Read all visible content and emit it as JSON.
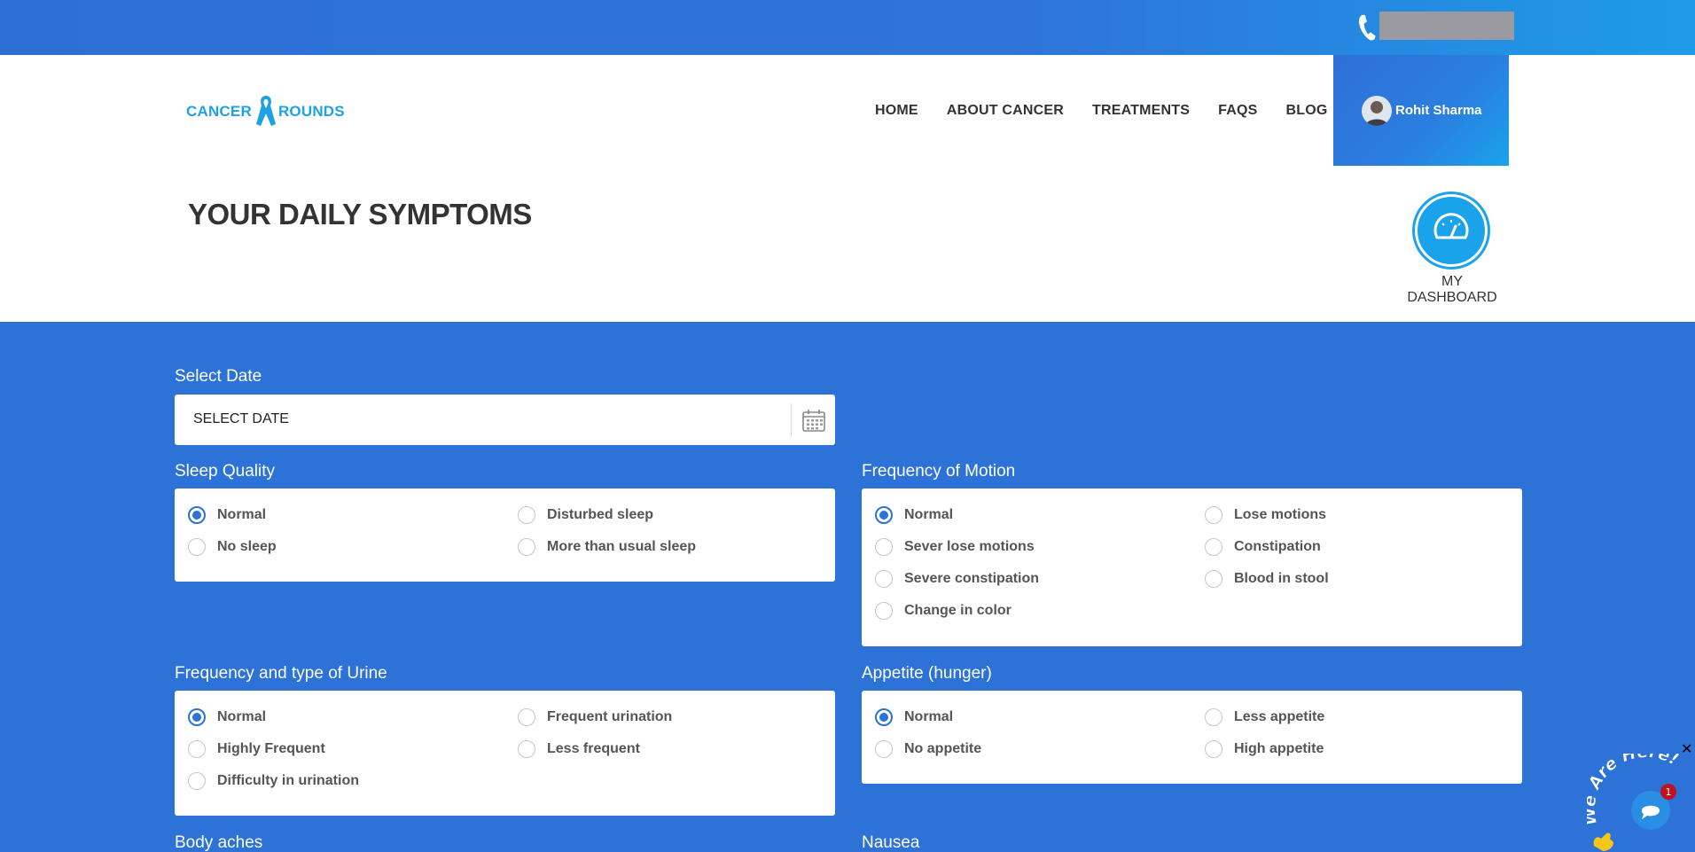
{
  "topbar": {
    "phone_icon": "phone-icon"
  },
  "logo": {
    "left": "CANCER",
    "right": "ROUNDS"
  },
  "nav": {
    "items": [
      "HOME",
      "ABOUT CANCER",
      "TREATMENTS",
      "FAQS",
      "BLOG"
    ]
  },
  "user": {
    "name": "Rohit Sharma"
  },
  "page": {
    "title": "YOUR DAILY SYMPTOMS",
    "dashboard_label": "MY DASHBOARD"
  },
  "date": {
    "label": "Select Date",
    "placeholder": "SELECT DATE"
  },
  "sections": {
    "sleep": {
      "label": "Sleep Quality",
      "options": [
        "Normal",
        "Disturbed sleep",
        "No sleep",
        "More than usual sleep"
      ],
      "selected": 0
    },
    "motion": {
      "label": "Frequency of Motion",
      "options": [
        "Normal",
        "Lose motions",
        "Sever lose motions",
        "Constipation",
        "Severe constipation",
        "Blood in stool",
        "Change in color"
      ],
      "selected": 0
    },
    "urine": {
      "label": "Frequency and type of Urine",
      "options": [
        "Normal",
        "Frequent urination",
        "Highly Frequent",
        "Less frequent",
        "Difficulty in urination"
      ],
      "selected": 0
    },
    "appetite": {
      "label": "Appetite (hunger)",
      "options": [
        "Normal",
        "Less appetite",
        "No appetite",
        "High appetite"
      ],
      "selected": 0
    },
    "body_aches": {
      "label": "Body aches"
    },
    "nausea": {
      "label": "Nausea"
    }
  },
  "chat": {
    "text": "We Are Here!",
    "badge": "1"
  },
  "colors": {
    "primary": "#2d72d6",
    "accent": "#1aa3ea"
  }
}
